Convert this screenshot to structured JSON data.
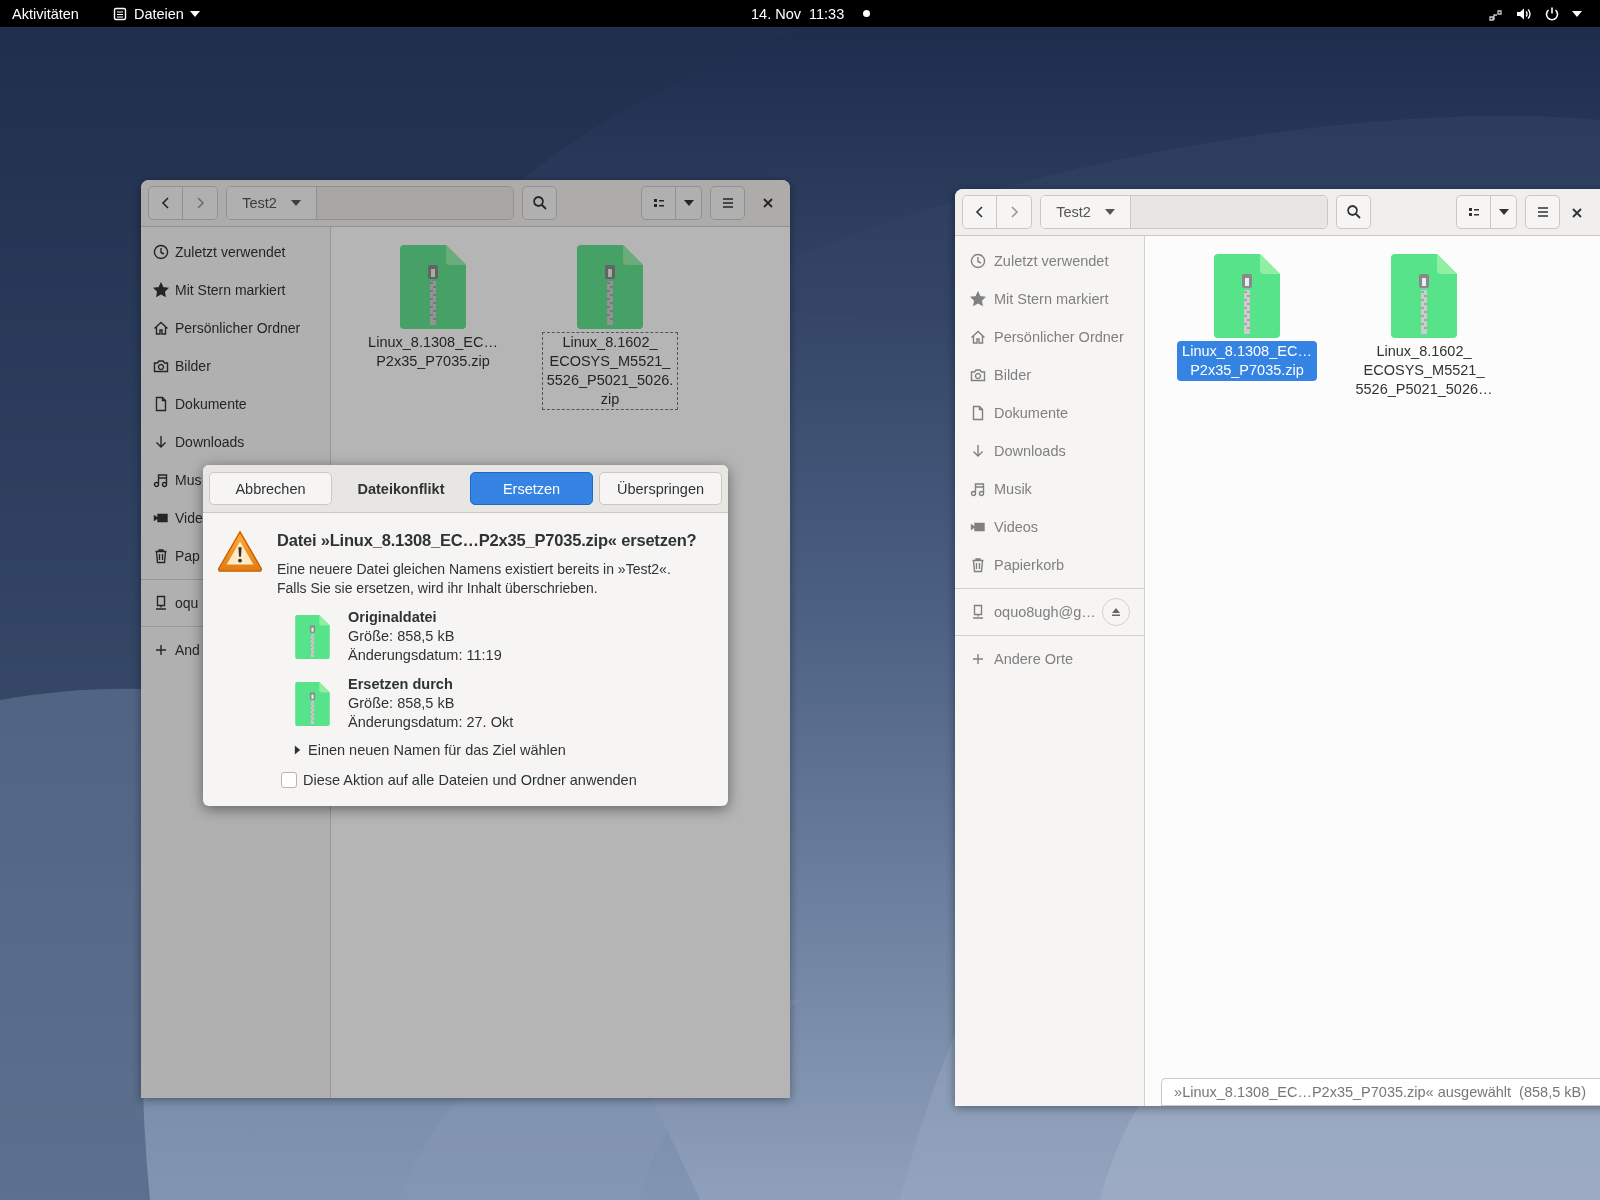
{
  "top_bar": {
    "activities": "Aktivitäten",
    "app_menu": "Dateien",
    "clock": "14. Nov  11:33",
    "notification": true
  },
  "windows": [
    {
      "backdrop": true,
      "path": "Test2",
      "sidebar": [
        "Zuletzt verwendet",
        "Mit Stern markiert",
        "Persönlicher Ordner",
        "Bilder",
        "Dokumente",
        "Downloads",
        "Mus",
        "Vide",
        "Pap"
      ],
      "network": {
        "label": "oqu"
      },
      "other": "And",
      "files": [
        {
          "name": "Linux_8.1308_EC…\nP2x35_P7035.zip",
          "selected": false,
          "focused": false
        },
        {
          "name": "Linux_8.1602_\nECOSYS_M5521_\n5526_P5021_5026.\nzip",
          "selected": false,
          "focused": true
        }
      ]
    },
    {
      "backdrop": false,
      "path": "Test2",
      "sidebar": [
        "Zuletzt verwendet",
        "Mit Stern markiert",
        "Persönlicher Ordner",
        "Bilder",
        "Dokumente",
        "Downloads",
        "Musik",
        "Videos",
        "Papierkorb"
      ],
      "network": {
        "label": "oquo8ugh@g…",
        "eject": true
      },
      "other": "Andere Orte",
      "files": [
        {
          "name": "Linux_8.1308_EC…\nP2x35_P7035.zip",
          "selected": true,
          "focused": false
        },
        {
          "name": "Linux_8.1602_\nECOSYS_M5521_\n5526_P5021_5026…",
          "selected": false,
          "focused": false
        }
      ],
      "status": "»Linux_8.1308_EC…P2x35_P7035.zip« ausgewählt  (858,5 kB)"
    }
  ],
  "dialog": {
    "cancel": "Abbrechen",
    "title": "Dateikonflikt",
    "replace": "Ersetzen",
    "skip": "Überspringen",
    "heading": "Datei »Linux_8.1308_EC…P2x35_P7035.zip« ersetzen?",
    "message": "Eine neuere Datei gleichen Namens existiert bereits in »Test2«.\nFalls Sie sie ersetzen, wird ihr Inhalt überschrieben.",
    "files": [
      {
        "title": "Originaldatei",
        "size": "Größe: 858,5 kB",
        "date": "Änderungsdatum: 11:19"
      },
      {
        "title": "Ersetzen durch",
        "size": "Größe: 858,5 kB",
        "date": "Änderungsdatum: 27. Okt"
      }
    ],
    "expander": {
      "label": "Einen neuen Namen für das Ziel wählen",
      "expanded": false
    },
    "apply_all": {
      "label": "Diese Aktion auf alle Dateien und Ordner anwenden",
      "checked": false
    }
  }
}
